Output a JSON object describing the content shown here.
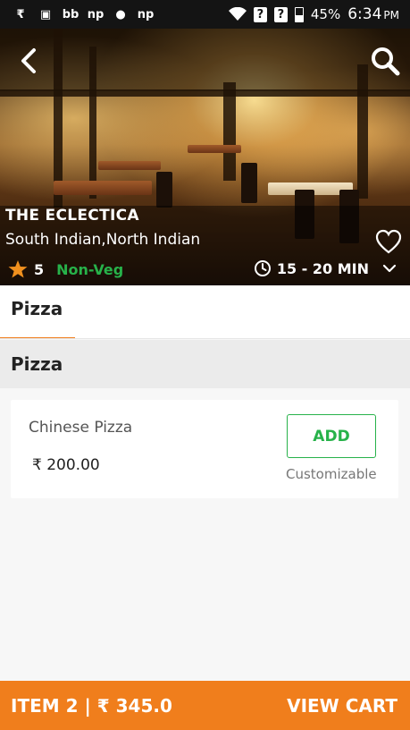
{
  "status_bar": {
    "left_icons": [
      "notification-icon",
      "image-icon",
      "bb-icon",
      "np-icon",
      "circle-icon",
      "np-icon"
    ],
    "left_glyphs": [
      "₹",
      "▣",
      "bb",
      "np",
      "●",
      "np"
    ],
    "battery": "45%",
    "time": "6:34",
    "ampm": "PM"
  },
  "restaurant": {
    "name": "THE ECLECTICA",
    "cuisine": "South Indian,North Indian",
    "rating": "5",
    "food_type": "Non-Veg",
    "delivery_time": "15 - 20 MIN"
  },
  "tabs": [
    {
      "label": "Pizza",
      "active": true
    }
  ],
  "section": {
    "title": "Pizza"
  },
  "items": [
    {
      "name": "Chinese Pizza",
      "price": "₹ 200.00",
      "add_label": "ADD",
      "note": "Customizable"
    }
  ],
  "cart": {
    "summary": "ITEM 2 | ₹ 345.0",
    "action": "VIEW CART"
  },
  "colors": {
    "accent": "#f07e1c",
    "veg_green": "#27b24a",
    "star": "#f0901e"
  }
}
